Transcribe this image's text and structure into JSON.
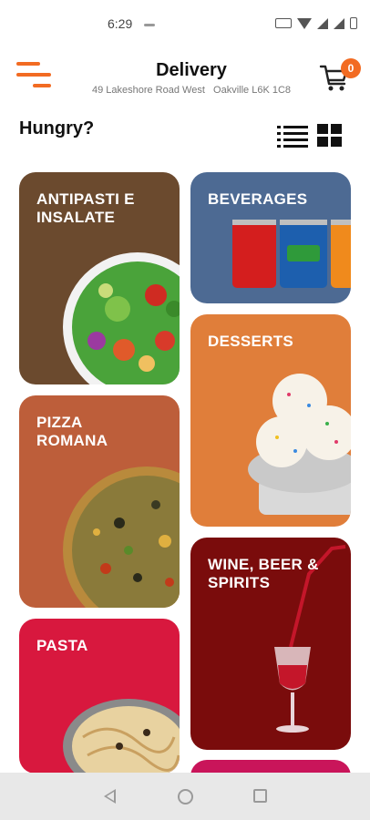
{
  "status_bar": {
    "time": "6:29"
  },
  "header": {
    "title": "Delivery",
    "address": "49 Lakeshore Road West   Oakville L6K 1C8",
    "cart_count": "0"
  },
  "heading": "Hungry?",
  "categories": [
    {
      "label": "ANTIPASTI E\nINSALATE",
      "color": "#6b4a2e"
    },
    {
      "label": "BEVERAGES",
      "color": "#4d6a93"
    },
    {
      "label": "PIZZA\nROMANA",
      "color": "#bd5e3a"
    },
    {
      "label": "DESSERTS",
      "color": "#e07e3a"
    },
    {
      "label": "PASTA",
      "color": "#d8183e"
    },
    {
      "label": "WINE, BEER &\nSPIRITS",
      "color": "#7a0c0c"
    },
    {
      "label": "",
      "color": "#c9155a"
    }
  ],
  "colors": {
    "accent": "#f26b22"
  },
  "icons": [
    "menu-icon",
    "cart-icon",
    "list-view-icon",
    "grid-view-icon",
    "back-icon",
    "home-icon",
    "recents-icon"
  ]
}
